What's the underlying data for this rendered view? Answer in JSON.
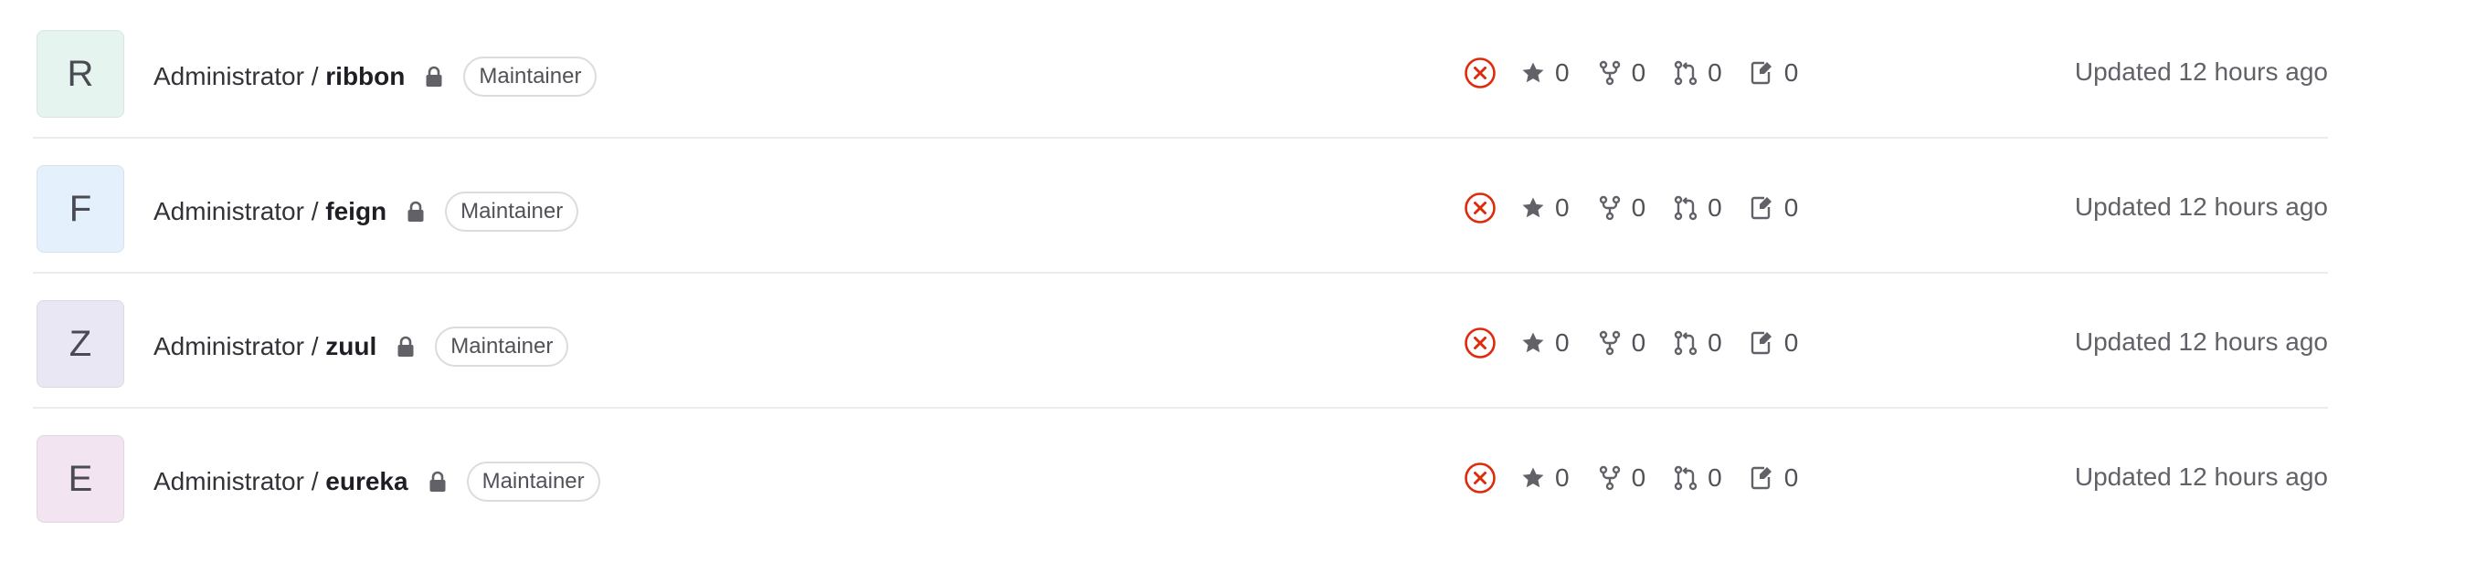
{
  "projects": [
    {
      "avatar_letter": "R",
      "avatar_bg": "#e6f4ef",
      "namespace": "Administrator / ",
      "name": "ribbon",
      "role": "Maintainer",
      "stars": "0",
      "forks": "0",
      "merge_requests": "0",
      "issues": "0",
      "updated": "Updated 12 hours ago"
    },
    {
      "avatar_letter": "F",
      "avatar_bg": "#e4f0fb",
      "namespace": "Administrator / ",
      "name": "feign",
      "role": "Maintainer",
      "stars": "0",
      "forks": "0",
      "merge_requests": "0",
      "issues": "0",
      "updated": "Updated 12 hours ago"
    },
    {
      "avatar_letter": "Z",
      "avatar_bg": "#e9e7f4",
      "namespace": "Administrator / ",
      "name": "zuul",
      "role": "Maintainer",
      "stars": "0",
      "forks": "0",
      "merge_requests": "0",
      "issues": "0",
      "updated": "Updated 12 hours ago"
    },
    {
      "avatar_letter": "E",
      "avatar_bg": "#f2e4f1",
      "namespace": "Administrator / ",
      "name": "eureka",
      "role": "Maintainer",
      "stars": "0",
      "forks": "0",
      "merge_requests": "0",
      "issues": "0",
      "updated": "Updated 12 hours ago"
    }
  ],
  "icons": {
    "visibility": "lock-icon",
    "pipeline_status": "status-failed-icon",
    "stars": "star-icon",
    "forks": "fork-icon",
    "merge_requests": "merge-request-icon",
    "issues": "issues-icon"
  },
  "colors": {
    "status_failed": "#dd2b0e",
    "icon_gray": "#626168",
    "divider": "#ececef"
  }
}
